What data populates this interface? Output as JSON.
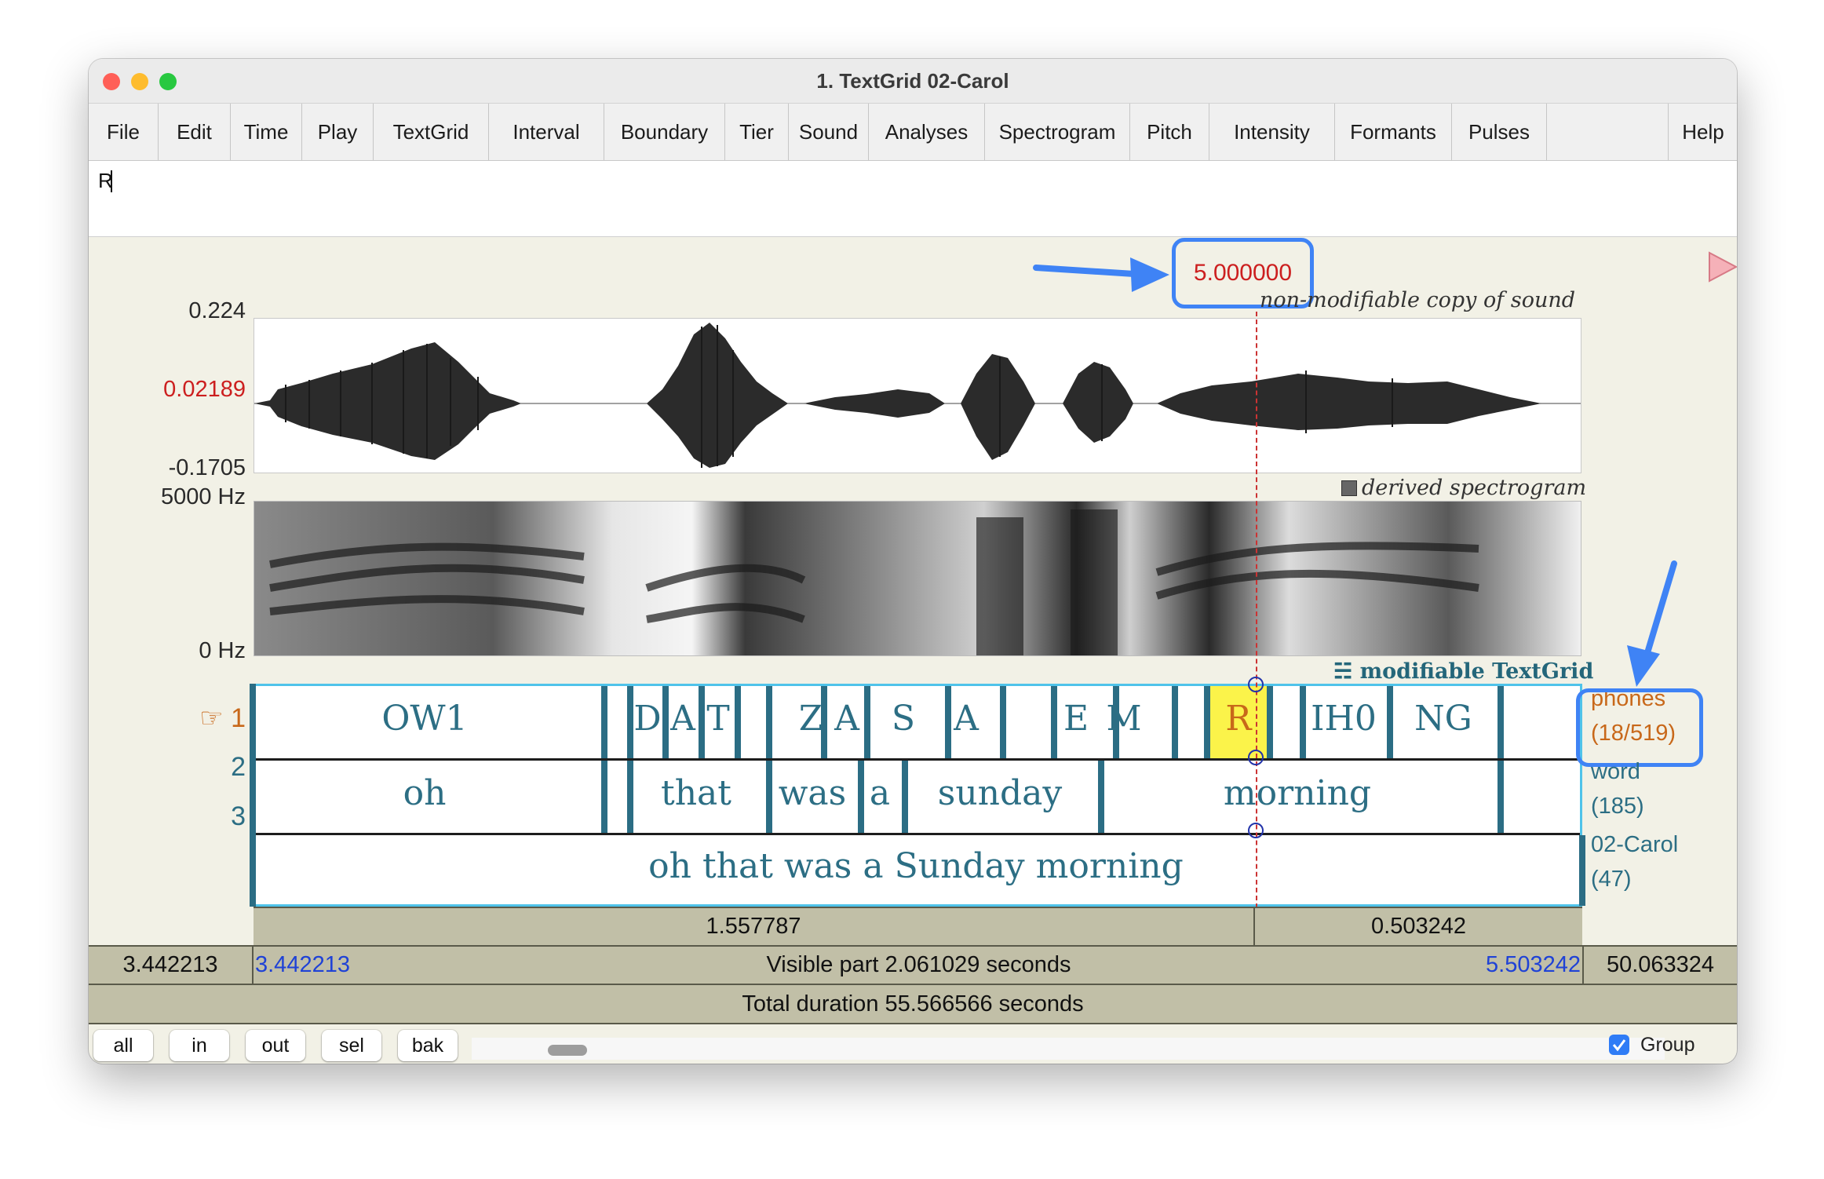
{
  "window": {
    "title": "1. TextGrid 02-Carol"
  },
  "menu": [
    "File",
    "Edit",
    "Time",
    "Play",
    "TextGrid",
    "Interval",
    "Boundary",
    "Tier",
    "Sound",
    "Analyses",
    "Spectrogram",
    "Pitch",
    "Intensity",
    "Formants",
    "Pulses",
    "Help"
  ],
  "text_field": {
    "value": "R"
  },
  "cursor_time": "5.000000",
  "sound": {
    "caption": "non-modifiable copy of sound",
    "y_max": "0.224",
    "y_cursor": "0.02189",
    "y_min": "-0.1705"
  },
  "spectrogram": {
    "caption": "derived spectrogram",
    "f_max": "5000 Hz",
    "f_min": "0 Hz"
  },
  "textgrid": {
    "caption": "modifiable TextGrid",
    "tiers": [
      {
        "number": "1",
        "name": "phones",
        "count": "(18/519)",
        "selected": true,
        "labels": [
          "OW1",
          "D",
          "A",
          "T",
          "Z",
          "A",
          "S",
          "A",
          "E",
          "M",
          "R",
          "IH0",
          "NG"
        ]
      },
      {
        "number": "2",
        "name": "word",
        "count": "(185)",
        "labels": [
          "oh",
          "that",
          "was",
          "a",
          "sunday",
          "morning"
        ]
      },
      {
        "number": "3",
        "name": "02-Carol",
        "count": "(47)",
        "labels": [
          "oh that was a Sunday morning"
        ]
      }
    ]
  },
  "time_bar": {
    "left_part": "1.557787",
    "right_part": "0.503242",
    "window_start": "3.442213",
    "visible_start": "3.442213",
    "visible_label": "Visible part 2.061029 seconds",
    "visible_end": "5.503242",
    "window_end": "50.063324",
    "total_label": "Total duration 55.566566 seconds"
  },
  "buttons": [
    "all",
    "in",
    "out",
    "sel",
    "bak"
  ],
  "group_checkbox": {
    "label": "Group",
    "checked": true
  },
  "colors": {
    "annotation_blue": "#3f83f5",
    "cursor_red": "#cc1f1f",
    "tier_teal": "#2c6e84",
    "selected_tier_orange": "#c8681a",
    "highlight_yellow": "#fbf34a"
  }
}
